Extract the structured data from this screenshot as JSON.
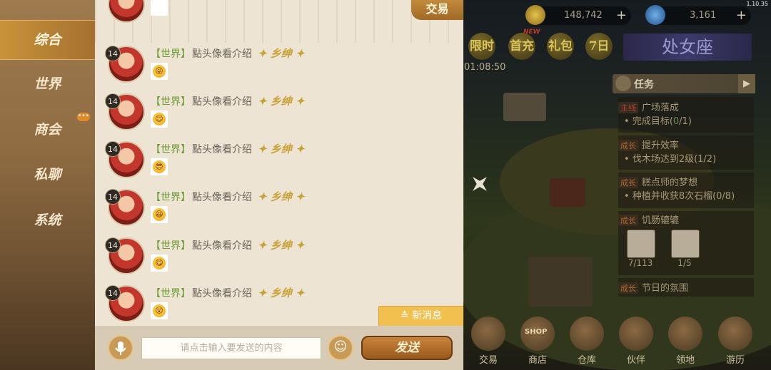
{
  "version": "1.10.35",
  "resources": [
    {
      "name": "gold-coin",
      "value": "148,742",
      "color": "#c9a23a"
    },
    {
      "name": "diamond",
      "value": "3,161",
      "color": "#3a7fc9"
    }
  ],
  "events": [
    "限时",
    "首充",
    "礼包",
    "7日"
  ],
  "event_new_label": "NEW",
  "timer": "01:08:50",
  "zodiac_banner": "处女座",
  "tasks": {
    "header": "任务",
    "items": [
      {
        "tag": "主线",
        "name": "广场落成",
        "desc": "完成目标(",
        "progress": "0",
        "desc_end": "/1)"
      },
      {
        "tag": "成长",
        "name": "提升效率",
        "desc": "伐木场达到2级(1/2)"
      },
      {
        "tag": "成长",
        "name": "糕点师的梦想",
        "desc": "种植并收获8次石榴(0/8)"
      },
      {
        "tag": "成长",
        "name": "饥肠辘辘"
      },
      {
        "tag": "成长",
        "name": "节日的氛围"
      }
    ],
    "slots": [
      {
        "icon": "eggs-icon",
        "count": "7/113"
      },
      {
        "icon": "flower-icon",
        "count": "1/5"
      }
    ]
  },
  "bottom_nav": [
    "交易",
    "商店",
    "仓库",
    "伙伴",
    "领地",
    "游历"
  ],
  "shop_sign": "SHOP",
  "side_tabs": {
    "active_index": 0,
    "items": [
      "综合",
      "世界",
      "商会",
      "私聊",
      "系统"
    ],
    "guild_badge": "•••"
  },
  "chat": {
    "trade_tab": "交易",
    "messages": [
      {
        "level": "14",
        "channel": "【世界】",
        "user": "點头像看介绍",
        "title": "乡绅",
        "emoji": "tongue"
      },
      {
        "level": "14",
        "channel": "【世界】",
        "user": "點头像看介绍",
        "title": "乡绅",
        "emoji": "relieved"
      },
      {
        "level": "14",
        "channel": "【世界】",
        "user": "點头像看介绍",
        "title": "乡绅",
        "emoji": "sunglasses"
      },
      {
        "level": "14",
        "channel": "【世界】",
        "user": "點头像看介绍",
        "title": "乡绅",
        "emoji": "laugh"
      },
      {
        "level": "14",
        "channel": "【世界】",
        "user": "點头像看介绍",
        "title": "乡绅",
        "emoji": "yum"
      },
      {
        "level": "14",
        "channel": "【世界】",
        "user": "點头像看介绍",
        "title": "乡绅",
        "emoji": "dizzy"
      }
    ],
    "new_messages": "新消息",
    "input_placeholder": "请点击输入要发送的内容",
    "send_label": "发送"
  }
}
